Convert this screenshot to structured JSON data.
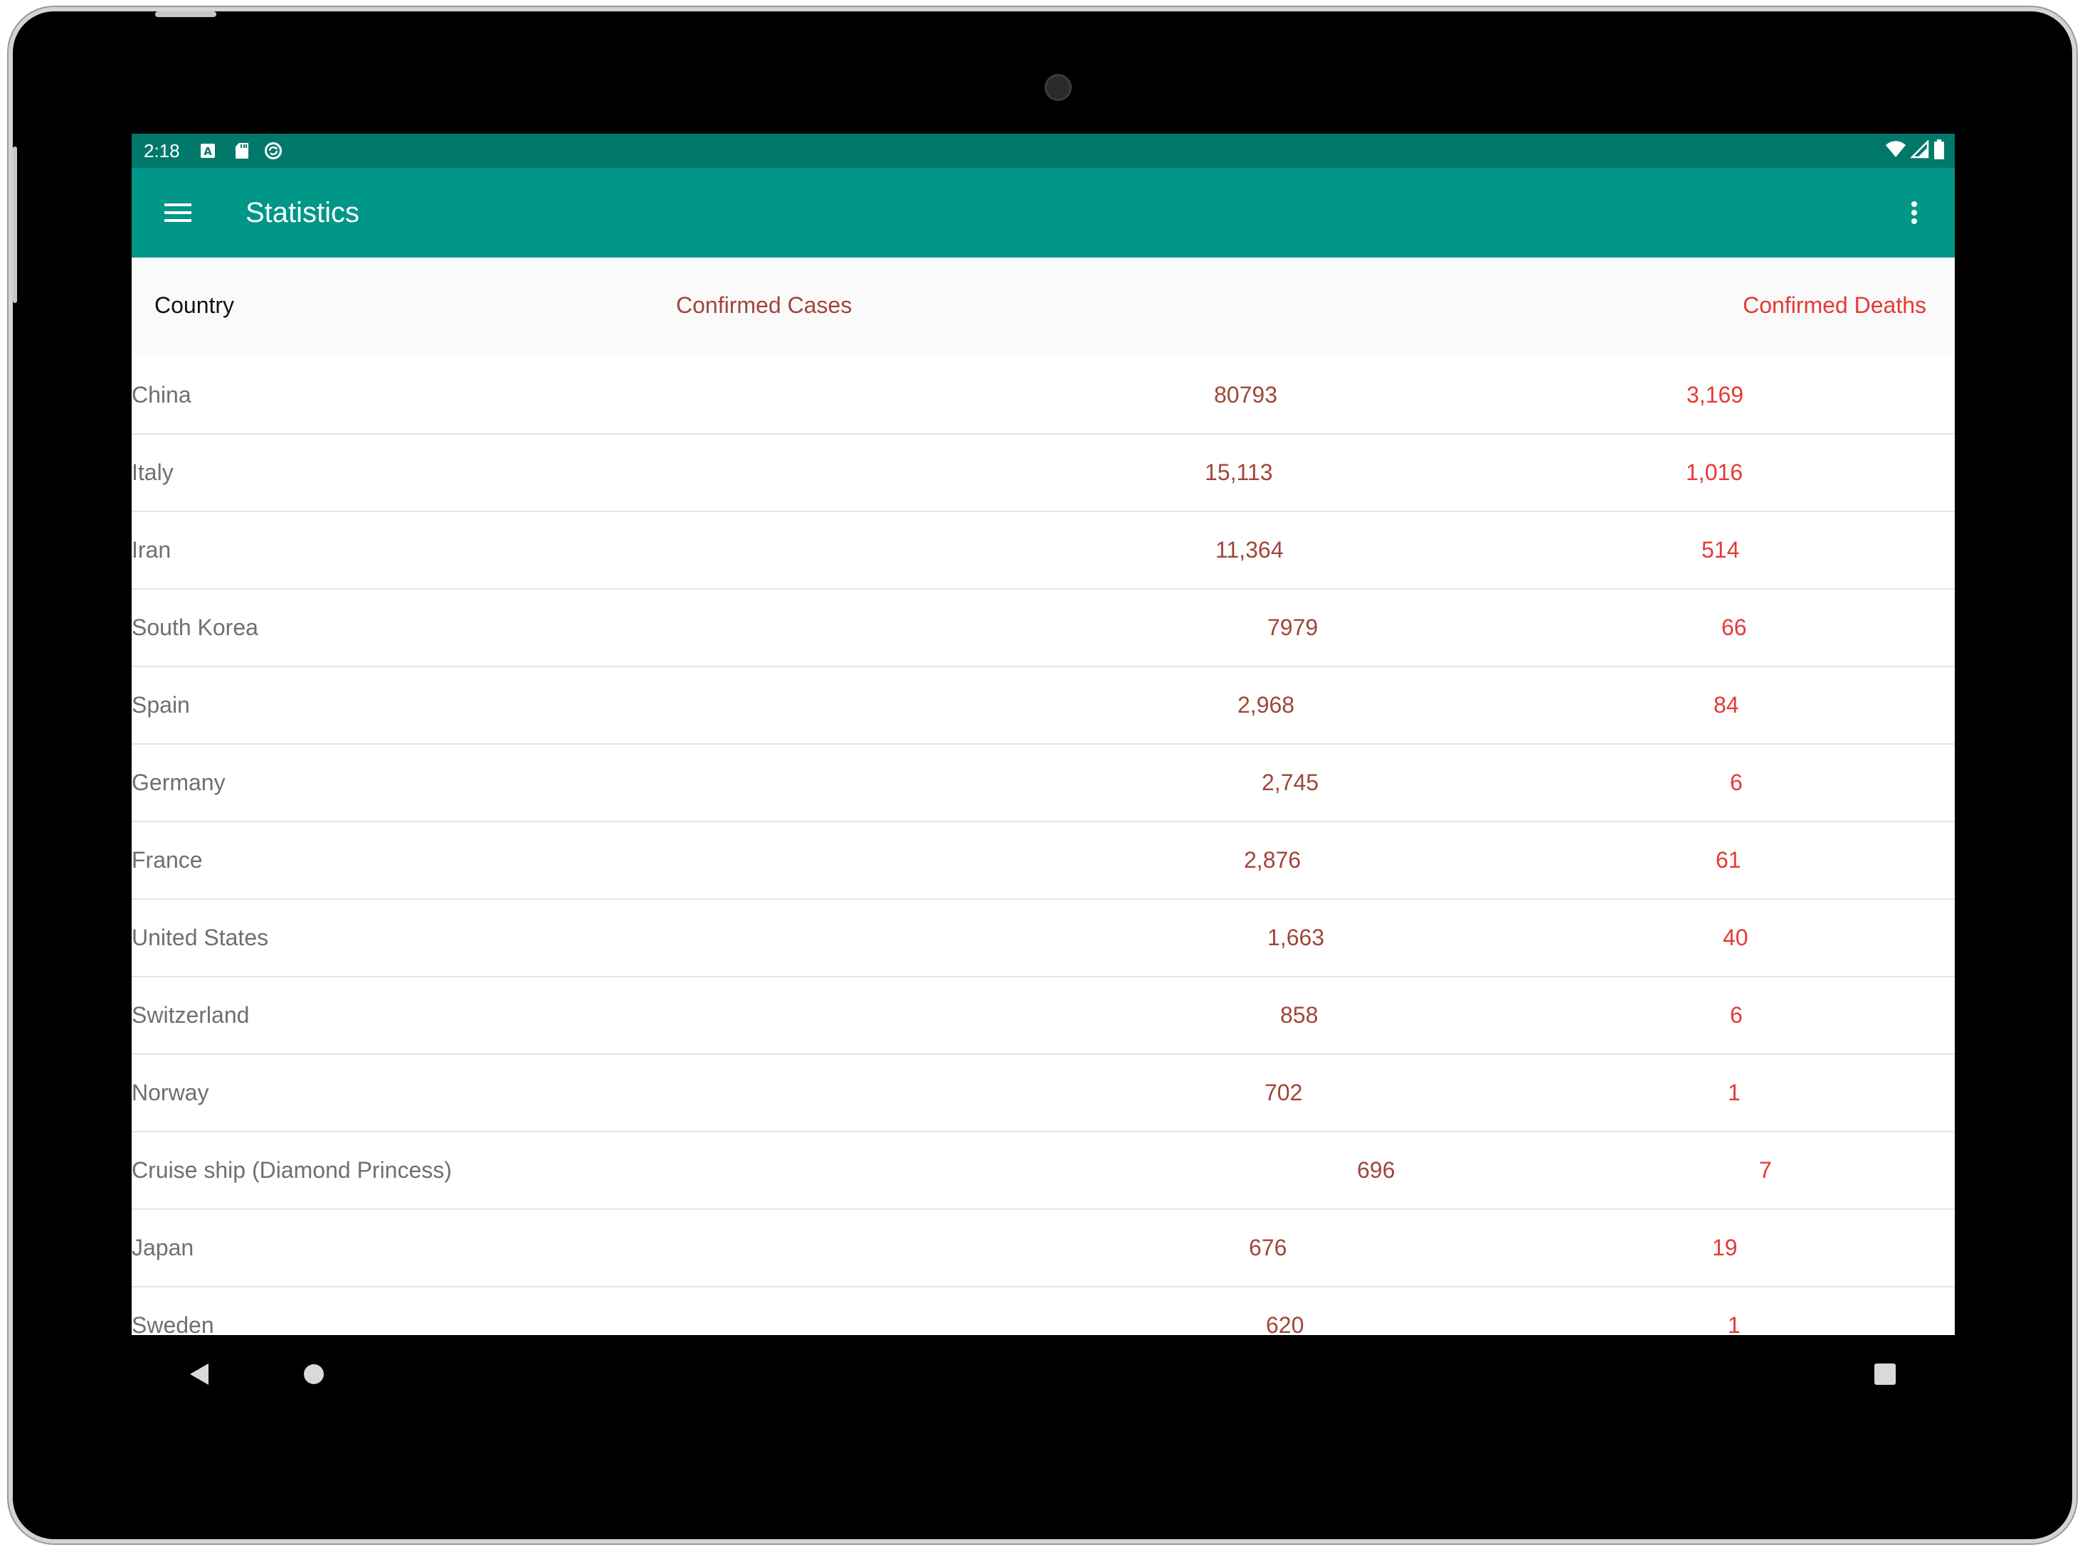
{
  "status_bar": {
    "time": "2:18",
    "left_icons": [
      "keyboard-a-icon",
      "sd-card-icon",
      "sync-icon"
    ],
    "right_icons": [
      "wifi-icon",
      "cell-signal-icon",
      "battery-icon"
    ]
  },
  "app_bar": {
    "title": "Statistics",
    "color": "#009688",
    "status_color": "#00796b"
  },
  "table": {
    "headers": {
      "country": "Country",
      "cases": "Confirmed Cases",
      "deaths": "Confirmed Deaths"
    },
    "colors": {
      "cases": "#a1453a",
      "deaths": "#e53935",
      "country": "#6f6f6f"
    },
    "rows": [
      {
        "country": "China",
        "cases": "80793",
        "deaths": "3,169"
      },
      {
        "country": "Italy",
        "cases": "15,113",
        "deaths": "1,016"
      },
      {
        "country": "Iran",
        "cases": "11,364",
        "deaths": "514"
      },
      {
        "country": "South Korea",
        "cases": "7979",
        "deaths": "66"
      },
      {
        "country": "Spain",
        "cases": "2,968",
        "deaths": "84"
      },
      {
        "country": "Germany",
        "cases": "2,745",
        "deaths": "6"
      },
      {
        "country": "France",
        "cases": "2,876",
        "deaths": "61"
      },
      {
        "country": "United States",
        "cases": "1,663",
        "deaths": "40"
      },
      {
        "country": "Switzerland",
        "cases": "858",
        "deaths": "6"
      },
      {
        "country": "Norway",
        "cases": "702",
        "deaths": "1"
      },
      {
        "country": "Cruise ship (Diamond Princess)",
        "cases": "696",
        "deaths": "7"
      },
      {
        "country": "Japan",
        "cases": "676",
        "deaths": "19"
      },
      {
        "country": "Sweden",
        "cases": "620",
        "deaths": "1"
      }
    ]
  },
  "nav_bar": {
    "buttons": [
      "back-icon",
      "home-icon",
      "recents-icon"
    ]
  }
}
